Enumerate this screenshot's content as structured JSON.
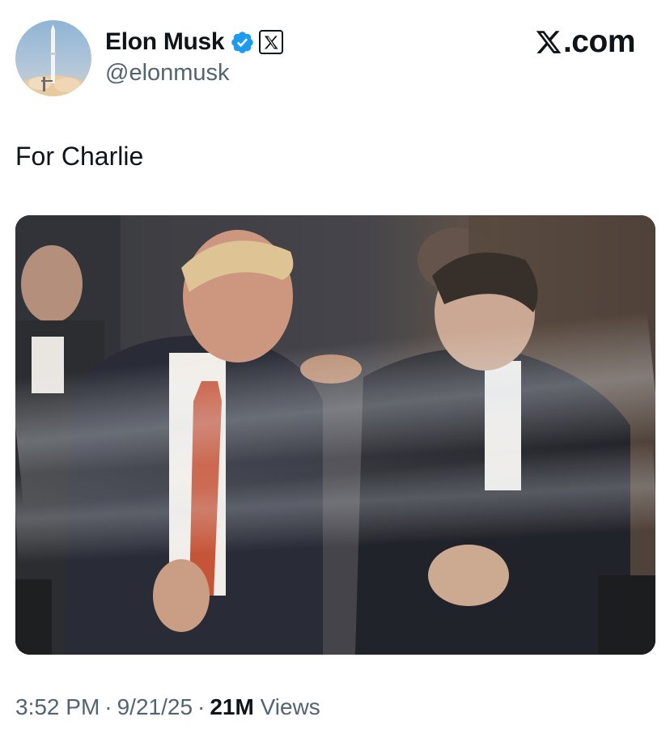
{
  "author": {
    "display_name": "Elon Musk",
    "handle": "@elonmusk",
    "verified": true,
    "verified_color": "#1d9bf0",
    "affiliation_badge": "x-logo-icon"
  },
  "brand": {
    "text": ".com"
  },
  "post": {
    "text": "For Charlie",
    "media_type": "photo"
  },
  "meta": {
    "time": "3:52 PM",
    "date": "9/21/25",
    "separator": "·",
    "views_count": "21M",
    "views_label": "Views"
  },
  "colors": {
    "text_primary": "#0f1419",
    "text_secondary": "#536471",
    "accent": "#1d9bf0"
  }
}
